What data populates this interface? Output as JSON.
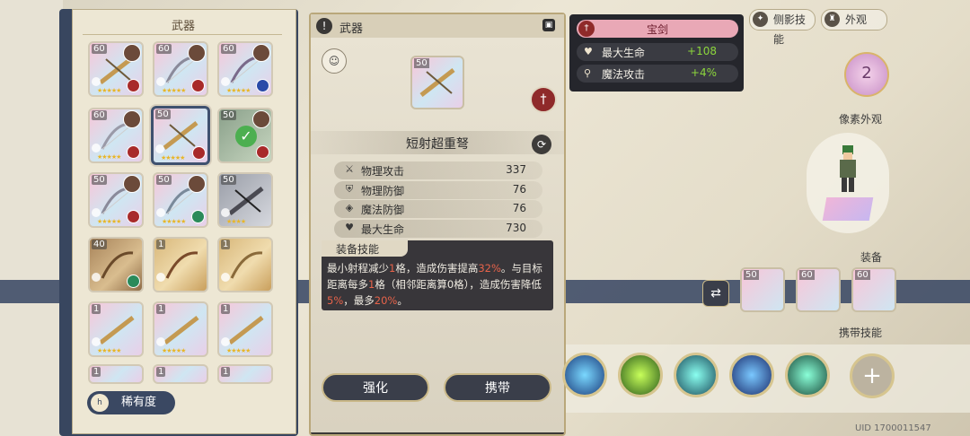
{
  "inventory": {
    "title": "武器",
    "rarity_button": {
      "icon_text": "h",
      "label": "稀有度"
    },
    "slots": [
      {
        "level": "60"
      },
      {
        "level": "60"
      },
      {
        "level": "60"
      },
      {
        "level": "60"
      },
      {
        "level": "50"
      },
      {
        "level": "50"
      },
      {
        "level": "50"
      },
      {
        "level": "50"
      },
      {
        "level": "50"
      },
      {
        "level": "40"
      },
      {
        "level": "1"
      },
      {
        "level": "1"
      },
      {
        "level": "1"
      },
      {
        "level": "1"
      },
      {
        "level": "1"
      },
      {
        "level": "1"
      },
      {
        "level": "1"
      },
      {
        "level": "1"
      }
    ]
  },
  "detail": {
    "header_title": "武器",
    "weapon_level": "50",
    "weapon_name": "短射超重弩",
    "stats": [
      {
        "label": "物理攻击",
        "value": "337"
      },
      {
        "label": "物理防御",
        "value": "76"
      },
      {
        "label": "魔法防御",
        "value": "76"
      },
      {
        "label": "最大生命",
        "value": "730"
      }
    ],
    "skill_title": "装备技能",
    "skill_desc_parts": [
      "最小射程减少",
      "1",
      "格，造成伤害提高",
      "32%",
      "。与目标距离每多",
      "1",
      "格（相邻距离算0格），造成伤害降低",
      "5%",
      "，最多",
      "20%",
      "。"
    ],
    "enhance_button": "强化",
    "equip_button": "携带"
  },
  "tooltip": {
    "title": "宝剑",
    "rows": [
      {
        "label": "最大生命",
        "value": "+108"
      },
      {
        "label": "魔法攻击",
        "value": "+4%"
      }
    ]
  },
  "tabs": [
    {
      "label": "侧影技能"
    },
    {
      "label": "外观"
    }
  ],
  "right": {
    "heart_value": "2",
    "pixel_label": "像素外观",
    "equip_label": "装备",
    "equip_levels": [
      "50",
      "60",
      "60"
    ],
    "skills_label": "携带技能",
    "uid": "UID 1700011547"
  },
  "colors": {
    "accent": "#38465f",
    "highlight": "#e8634a",
    "positive": "#8cd63c",
    "card_dark": "#3a3836"
  }
}
